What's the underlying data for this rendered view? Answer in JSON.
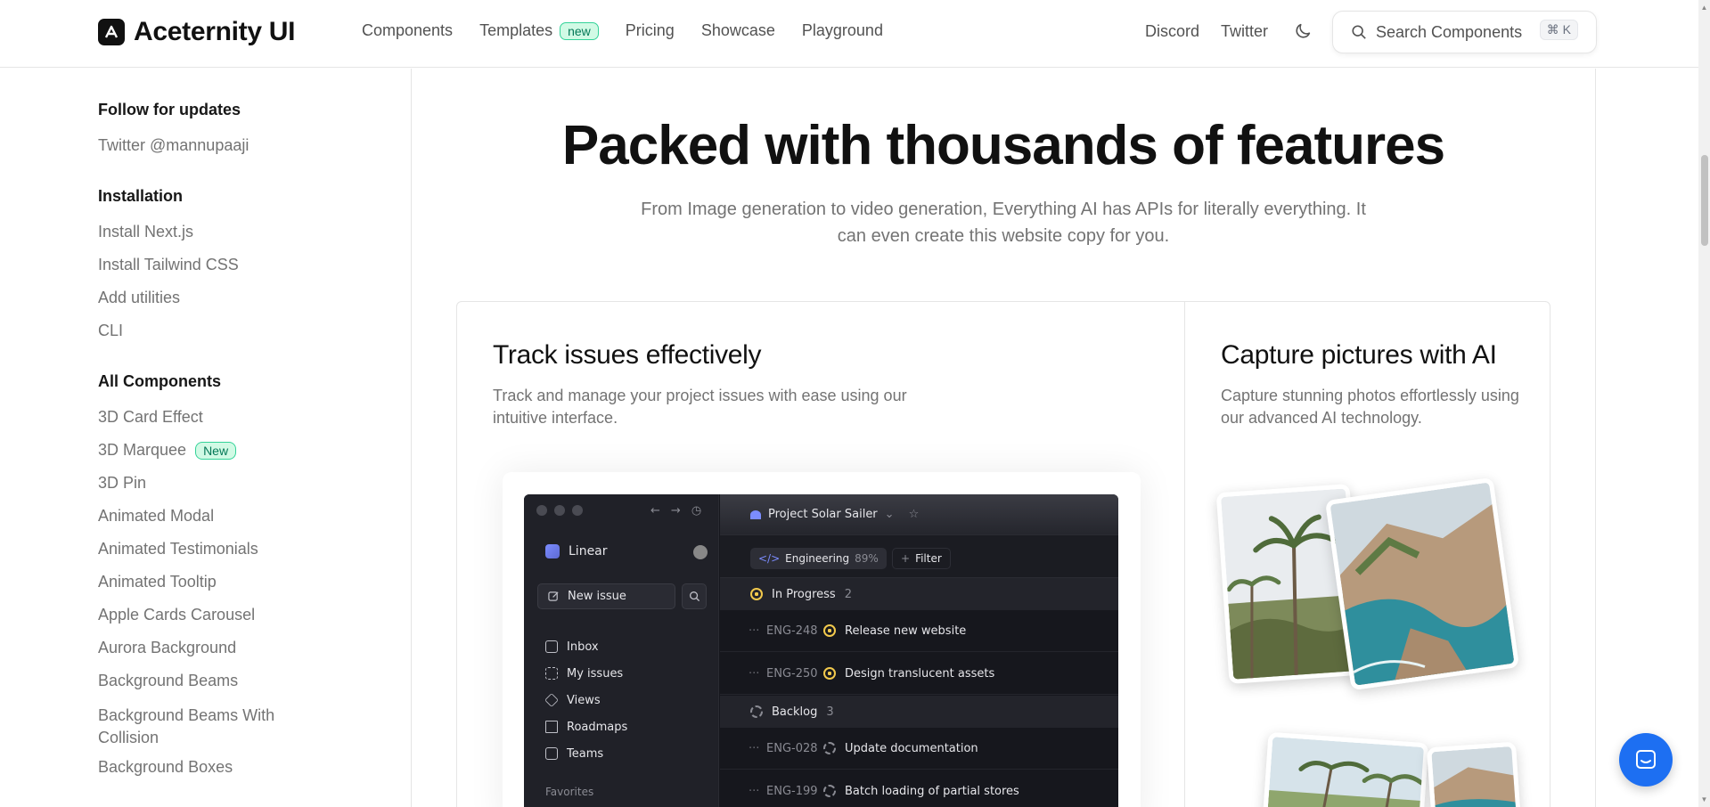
{
  "navbar": {
    "brand": "Aceternity UI",
    "links": [
      {
        "label": "Components"
      },
      {
        "label": "Templates",
        "badge": "new"
      },
      {
        "label": "Pricing"
      },
      {
        "label": "Showcase"
      },
      {
        "label": "Playground"
      }
    ],
    "right_links": [
      {
        "label": "Discord"
      },
      {
        "label": "Twitter"
      }
    ],
    "search_label": "Search Components",
    "search_shortcut": "⌘ K"
  },
  "sidebar": {
    "follow_heading": "Follow for updates",
    "follow_item": "Twitter @mannupaaji",
    "installation_heading": "Installation",
    "installation_items": [
      "Install Next.js",
      "Install Tailwind CSS",
      "Add utilities",
      "CLI"
    ],
    "components_heading": "All Components",
    "components_items": [
      {
        "label": "3D Card Effect"
      },
      {
        "label": "3D Marquee",
        "badge": "New"
      },
      {
        "label": "3D Pin"
      },
      {
        "label": "Animated Modal"
      },
      {
        "label": "Animated Testimonials"
      },
      {
        "label": "Animated Tooltip"
      },
      {
        "label": "Apple Cards Carousel"
      },
      {
        "label": "Aurora Background"
      },
      {
        "label": "Background Beams"
      },
      {
        "label": "Background Beams With Collision"
      },
      {
        "label": "Background Boxes"
      }
    ]
  },
  "hero": {
    "title": "Packed with thousands of features",
    "subtitle": "From Image generation to video generation, Everything AI has APIs for literally everything. It can even create this website copy for you."
  },
  "cards": [
    {
      "title": "Track issues effectively",
      "desc": "Track and manage your project issues with ease using our intuitive interface."
    },
    {
      "title": "Capture pictures with AI",
      "desc": "Capture stunning photos effortlessly using our advanced AI technology."
    }
  ],
  "linear_app": {
    "workspace": "Linear",
    "new_issue": "New issue",
    "menu": [
      "Inbox",
      "My issues",
      "Views",
      "Roadmaps",
      "Teams"
    ],
    "favorites": "Favorites",
    "project": "Project Solar Sailer",
    "team_chip": "Engineering",
    "team_pct": "89%",
    "filter_chip": "Filter",
    "group_in_progress": "In Progress",
    "group_in_progress_count": "2",
    "group_backlog": "Backlog",
    "group_backlog_count": "3",
    "issues": [
      {
        "id": "ENG-248",
        "title": "Release new website",
        "status": "in-progress"
      },
      {
        "id": "ENG-250",
        "title": "Design translucent assets",
        "status": "in-progress"
      },
      {
        "id": "ENG-028",
        "title": "Update documentation",
        "status": "backlog"
      },
      {
        "id": "ENG-199",
        "title": "Batch loading of partial stores",
        "status": "backlog"
      }
    ]
  },
  "colors": {
    "accent_green": "#34d399",
    "chat_button": "#1d6ff2",
    "app_bg": "#16171d"
  }
}
